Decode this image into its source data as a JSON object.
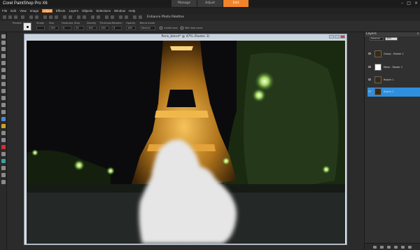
{
  "app": {
    "title": "Corel PaintShop Pro X6",
    "workspace_tabs": [
      {
        "label": "Manage",
        "active": false
      },
      {
        "label": "Adjust",
        "active": false
      },
      {
        "label": "Edit",
        "active": true
      }
    ],
    "window_controls": [
      "–",
      "□",
      "×"
    ],
    "accent": "#f0842a"
  },
  "menu": [
    "File",
    "Edit",
    "View",
    "Image",
    "Adjust",
    "Effects",
    "Layers",
    "Objects",
    "Selections",
    "Window",
    "Help"
  ],
  "menu_active_index": 4,
  "standard_toolbar": {
    "enhance_photo": "Enhance Photo",
    "palettes": "Palettes"
  },
  "tool_options": {
    "presets_label": "Presets",
    "shape_label": "Shape",
    "size_label": "Size",
    "size_value": "200",
    "hardness_label": "Hardness",
    "hardness_value": "0",
    "step_label": "Step",
    "step_value": "10",
    "density_label": "Density",
    "density_value": "100",
    "thickness_label": "Thickness",
    "thickness_value": "100",
    "rotation_label": "Rotation",
    "rotation_value": "0",
    "opacity_label": "Opacity",
    "opacity_value": "100",
    "blend_label": "Blend mode",
    "blend_value": "Normal",
    "continuous_label": "Continuous",
    "wet_look_label": "Wet look paint"
  },
  "document": {
    "title": "Paris_blend* @ 47% (Raster 2)"
  },
  "layers_palette": {
    "header": "Layers",
    "close": "×",
    "blend_mode": "Normal",
    "opacity": "100",
    "layers": [
      {
        "name": "Group - Raster 1",
        "selected": false,
        "thumb": "tower"
      },
      {
        "name": "Mask - Raster 1",
        "selected": false,
        "thumb": "mask"
      },
      {
        "name": "Raster 1",
        "selected": false,
        "thumb": "tower"
      },
      {
        "name": "Raster 2",
        "selected": true,
        "thumb": "tower"
      }
    ],
    "selection_color": "#2f8fdf"
  }
}
